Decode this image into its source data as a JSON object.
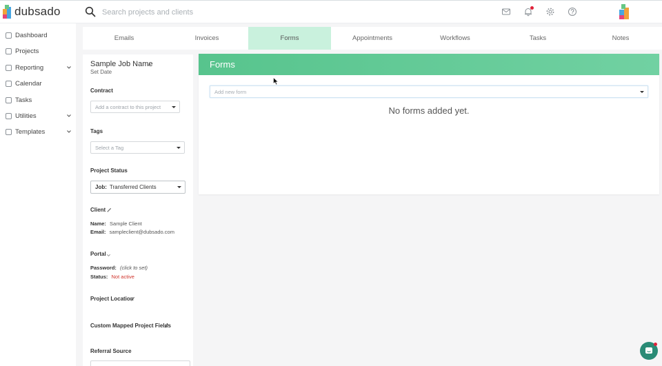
{
  "app": {
    "logo_text": "dubsado",
    "search": {
      "placeholder": "Search projects and clients"
    },
    "top_icons": [
      "mail-icon",
      "bell-icon",
      "gear-icon",
      "help-icon"
    ],
    "notification_color": "#e0223a"
  },
  "sidebar": {
    "items": [
      {
        "label": "Dashboard",
        "icon": "dashboard-icon",
        "expandable": false
      },
      {
        "label": "Projects",
        "icon": "projects-icon",
        "expandable": false
      },
      {
        "label": "Reporting",
        "icon": "reporting-icon",
        "expandable": true
      },
      {
        "label": "Calendar",
        "icon": "calendar-icon",
        "expandable": false
      },
      {
        "label": "Tasks",
        "icon": "tasks-icon",
        "expandable": false
      },
      {
        "label": "Utilities",
        "icon": "utilities-icon",
        "expandable": true
      },
      {
        "label": "Templates",
        "icon": "templates-icon",
        "expandable": true
      }
    ]
  },
  "tabs": [
    {
      "label": "Emails"
    },
    {
      "label": "Invoices"
    },
    {
      "label": "Forms",
      "active": true
    },
    {
      "label": "Appointments"
    },
    {
      "label": "Workflows"
    },
    {
      "label": "Tasks"
    },
    {
      "label": "Notes"
    }
  ],
  "project": {
    "name": "Sample Job Name",
    "set_date": "Set Date",
    "contract": {
      "title": "Contract",
      "placeholder": "Add a contract to this project"
    },
    "tags": {
      "title": "Tags",
      "placeholder": "Select a Tag"
    },
    "status": {
      "title": "Project Status",
      "label": "Job:",
      "value": "Transferred Clients"
    },
    "client": {
      "title": "Client",
      "name_label": "Name:",
      "name": "Sample Client",
      "email_label": "Email:",
      "email": "sampleclient@dubsado.com"
    },
    "portal": {
      "title": "Portal",
      "password_label": "Password:",
      "password": "(click to set)",
      "status_label": "Status:",
      "status": "Not active"
    },
    "location": {
      "title": "Project Location"
    },
    "custom_fields": {
      "title": "Custom Mapped Project Fields"
    },
    "referral": {
      "title": "Referral Source"
    }
  },
  "forms": {
    "title": "Forms",
    "add_placeholder": "Add new form",
    "empty_message": "No forms added yet.",
    "header_color": "#5cc691"
  },
  "colors": {
    "active_tab": "#c9f1dd",
    "accent_green": "#57c48d",
    "chat": "#2a8b76",
    "inactive_red": "#d0342c"
  }
}
